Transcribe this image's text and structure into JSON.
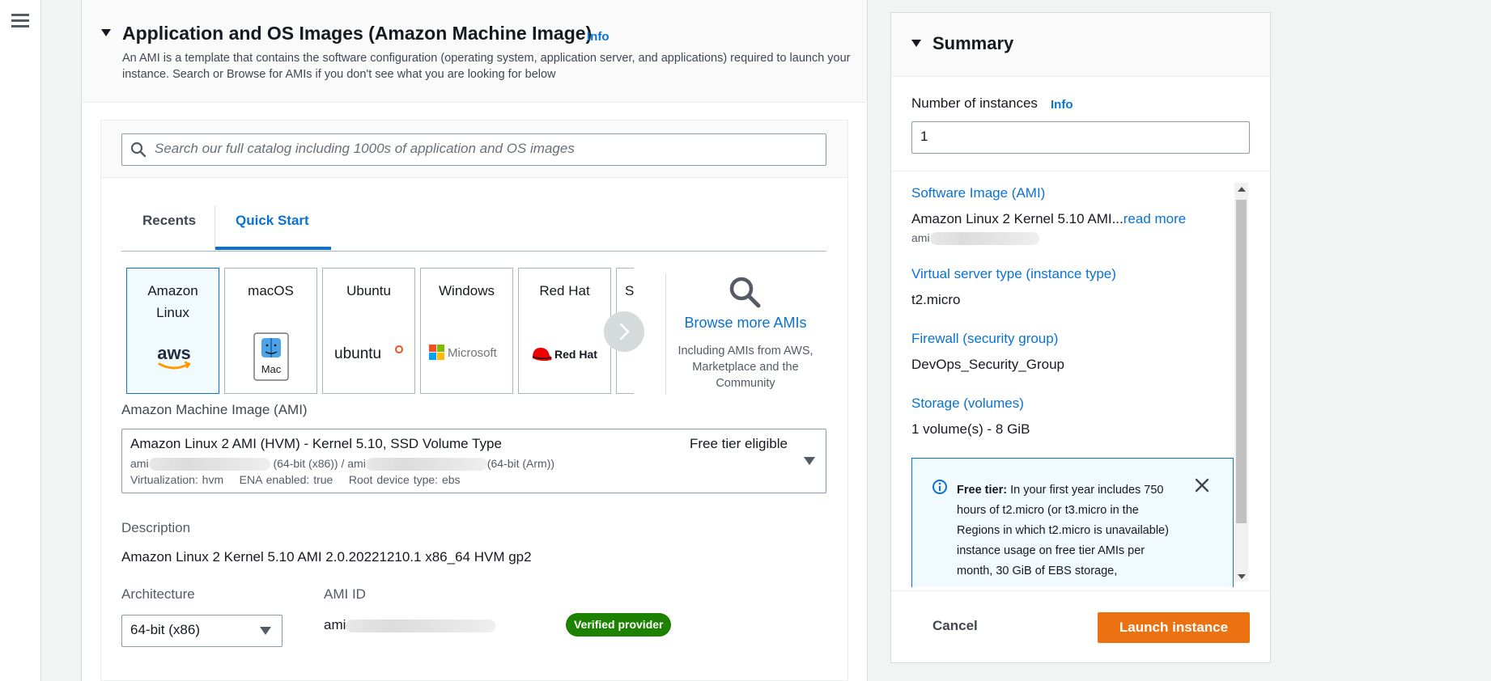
{
  "ami_section": {
    "title": "Application and OS Images (Amazon Machine Image)",
    "info": "Info",
    "description": "An AMI is a template that contains the software configuration (operating system, application server, and applications) required to launch your instance. Search or Browse for AMIs if you don't see what you are looking for below",
    "search_placeholder": "Search our full catalog including 1000s of application and OS images",
    "tabs": [
      {
        "label": "Recents",
        "selected": false
      },
      {
        "label": "Quick Start",
        "selected": true
      }
    ],
    "os_cards": [
      {
        "label": "Amazon Linux",
        "logo": "aws-logo",
        "logo_text": "aws",
        "selected": true
      },
      {
        "label": "macOS",
        "logo": "mac-finder-logo",
        "logo_text": "Mac",
        "selected": false
      },
      {
        "label": "Ubuntu",
        "logo": "ubuntu-logo",
        "logo_text": "ubuntu",
        "selected": false
      },
      {
        "label": "Windows",
        "logo": "microsoft-logo",
        "logo_text": "Microsoft",
        "selected": false
      },
      {
        "label": "Red Hat",
        "logo": "redhat-logo",
        "logo_text": "Red Hat",
        "selected": false
      },
      {
        "label": "S",
        "logo": "",
        "selected": false
      }
    ],
    "browse_more": {
      "label": "Browse more AMIs",
      "sub": "Including AMIs from AWS, Marketplace and the Community"
    },
    "ami_label": "Amazon Machine Image (AMI)",
    "ami_selected": {
      "name": "Amazon Linux 2 AMI (HVM) - Kernel 5.10, SSD Volume Type",
      "badge": "Free tier eligible",
      "id_prefix_1": "ami",
      "id_suffix_1": "(64-bit (x86)) / ami",
      "id_suffix_2": "(64-bit (Arm))",
      "meta": "Virtualization: hvm    ENA enabled: true    Root device type: ebs"
    },
    "description_label": "Description",
    "description_value": "Amazon Linux 2 Kernel 5.10 AMI 2.0.20221210.1 x86_64 HVM gp2",
    "architecture_label": "Architecture",
    "architecture_value": "64-bit (x86)",
    "ami_id_label": "AMI ID",
    "ami_id_prefix": "ami",
    "verified_badge": "Verified provider"
  },
  "summary": {
    "title": "Summary",
    "num_instances_label": "Number of instances",
    "num_instances_info": "Info",
    "num_instances_value": "1",
    "software_image_label": "Software Image (AMI)",
    "software_image_value": "Amazon Linux 2 Kernel 5.10 AMI...",
    "software_image_readmore": "read more",
    "software_image_id_prefix": "ami",
    "instance_type_label": "Virtual server type (instance type)",
    "instance_type_value": "t2.micro",
    "firewall_label": "Firewall (security group)",
    "firewall_value": "DevOps_Security_Group",
    "storage_label": "Storage (volumes)",
    "storage_value": "1 volume(s) - 8 GiB",
    "free_tier_title": "Free tier:",
    "free_tier_text": "In your first year includes 750 hours of t2.micro (or t3.micro in the Regions in which t2.micro is unavailable) instance usage on free tier AMIs per month, 30 GiB of EBS storage,",
    "cancel": "Cancel",
    "launch": "Launch instance"
  },
  "colors": {
    "accent": "#0972d3",
    "launch": "#ec7211",
    "verified": "#1d8102"
  }
}
